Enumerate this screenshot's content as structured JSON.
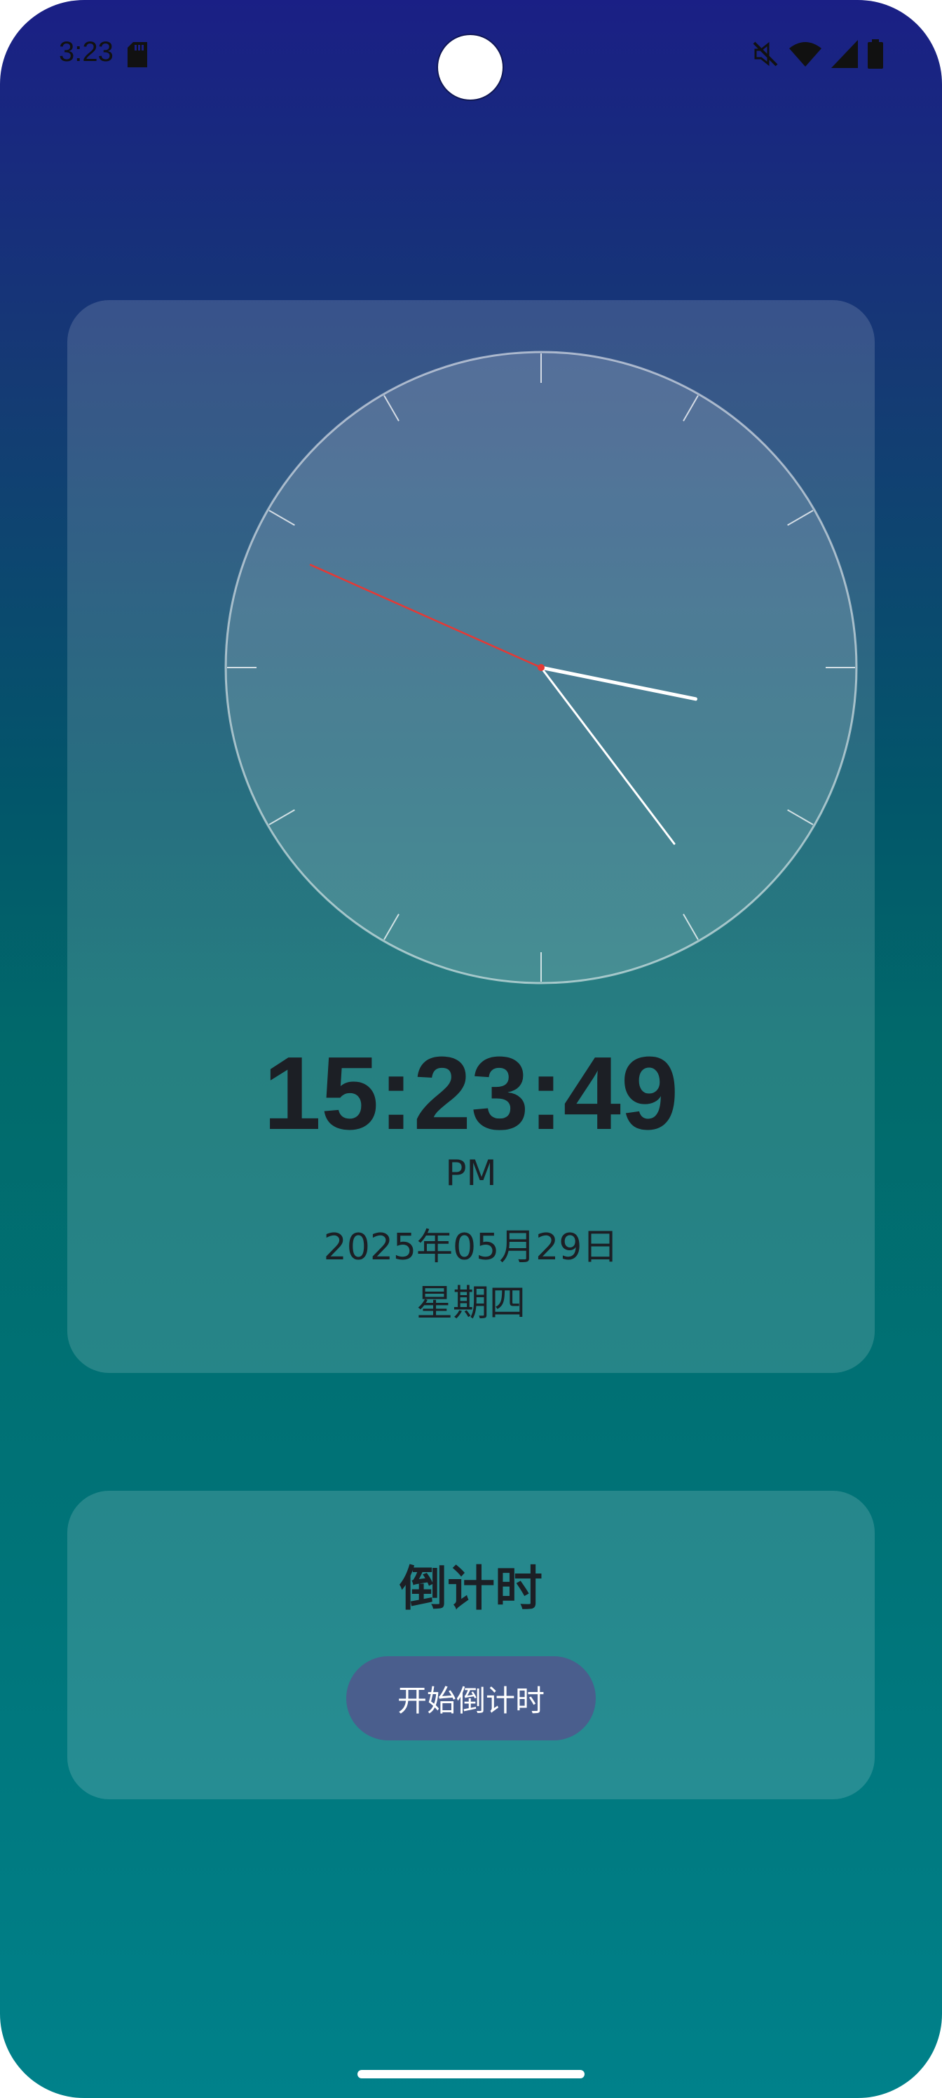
{
  "status_bar": {
    "time": "3:23",
    "icons": [
      "sd-card-icon",
      "mute-icon",
      "wifi-icon",
      "signal-icon",
      "battery-icon"
    ]
  },
  "clock": {
    "digital_time": "15:23:49",
    "ampm": "PM",
    "date": "2025年05月29日",
    "weekday": "星期四",
    "analog": {
      "hour": 3,
      "minute": 23,
      "second": 49
    }
  },
  "countdown": {
    "title": "倒计时",
    "start_label": "开始倒计时"
  },
  "colors": {
    "gradient_top": "#1a1f85",
    "gradient_bottom": "#00818a",
    "button_bg": "#4a5e8d",
    "second_hand": "#e53935",
    "text_dark": "#1c1f25"
  }
}
